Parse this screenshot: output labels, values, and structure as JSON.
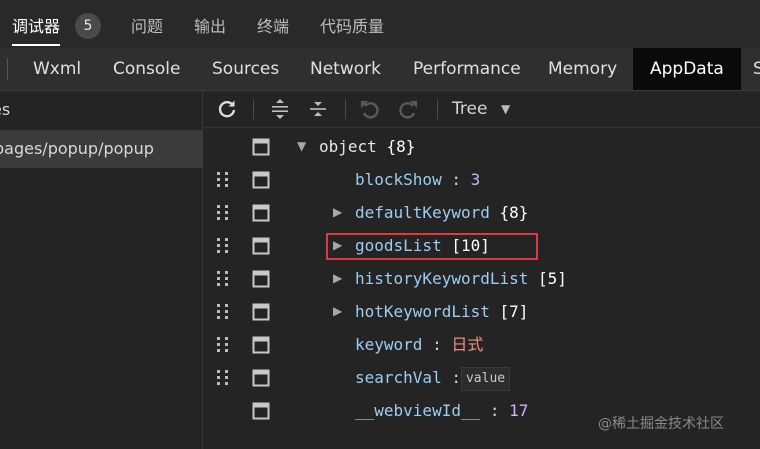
{
  "top_tabs": [
    {
      "label": "调试器",
      "badge": "5",
      "active": true
    },
    {
      "label": "问题"
    },
    {
      "label": "输出"
    },
    {
      "label": "终端"
    },
    {
      "label": "代码质量"
    }
  ],
  "panel_tabs": [
    "Wxml",
    "Console",
    "Sources",
    "Network",
    "Performance",
    "Memory",
    "AppData",
    "S"
  ],
  "active_panel": "AppData",
  "sidebar": {
    "items": [
      {
        "label": "es"
      },
      {
        "label": "pages/popup/popup",
        "selected": true
      }
    ]
  },
  "toolbar": {
    "icons": [
      "refresh-icon",
      "expand-all-icon",
      "collapse-all-icon",
      "undo-icon",
      "redo-icon"
    ],
    "view_mode": "Tree"
  },
  "tree": {
    "root": {
      "name": "object",
      "count": "{8}"
    },
    "rows": [
      {
        "key": "blockShow",
        "value": "3",
        "type": "number"
      },
      {
        "key": "defaultKeyword",
        "summary": "{8}",
        "expandable": true
      },
      {
        "key": "goodsList",
        "summary": "[10]",
        "expandable": true,
        "highlighted": true
      },
      {
        "key": "historyKeywordList",
        "summary": "[5]",
        "expandable": true
      },
      {
        "key": "hotKeywordList",
        "summary": "[7]",
        "expandable": true
      },
      {
        "key": "keyword",
        "value": "日式",
        "type": "string"
      },
      {
        "key": "searchVal",
        "value": "value",
        "type": "empty"
      },
      {
        "key": "__webviewId__",
        "value": "17",
        "type": "number"
      }
    ]
  },
  "colors": {
    "highlight": "#e0393e",
    "key": "#9ccdf0",
    "number": "#c8b8f8",
    "string": "#f09080"
  },
  "watermark": "@稀土掘金技术社区"
}
